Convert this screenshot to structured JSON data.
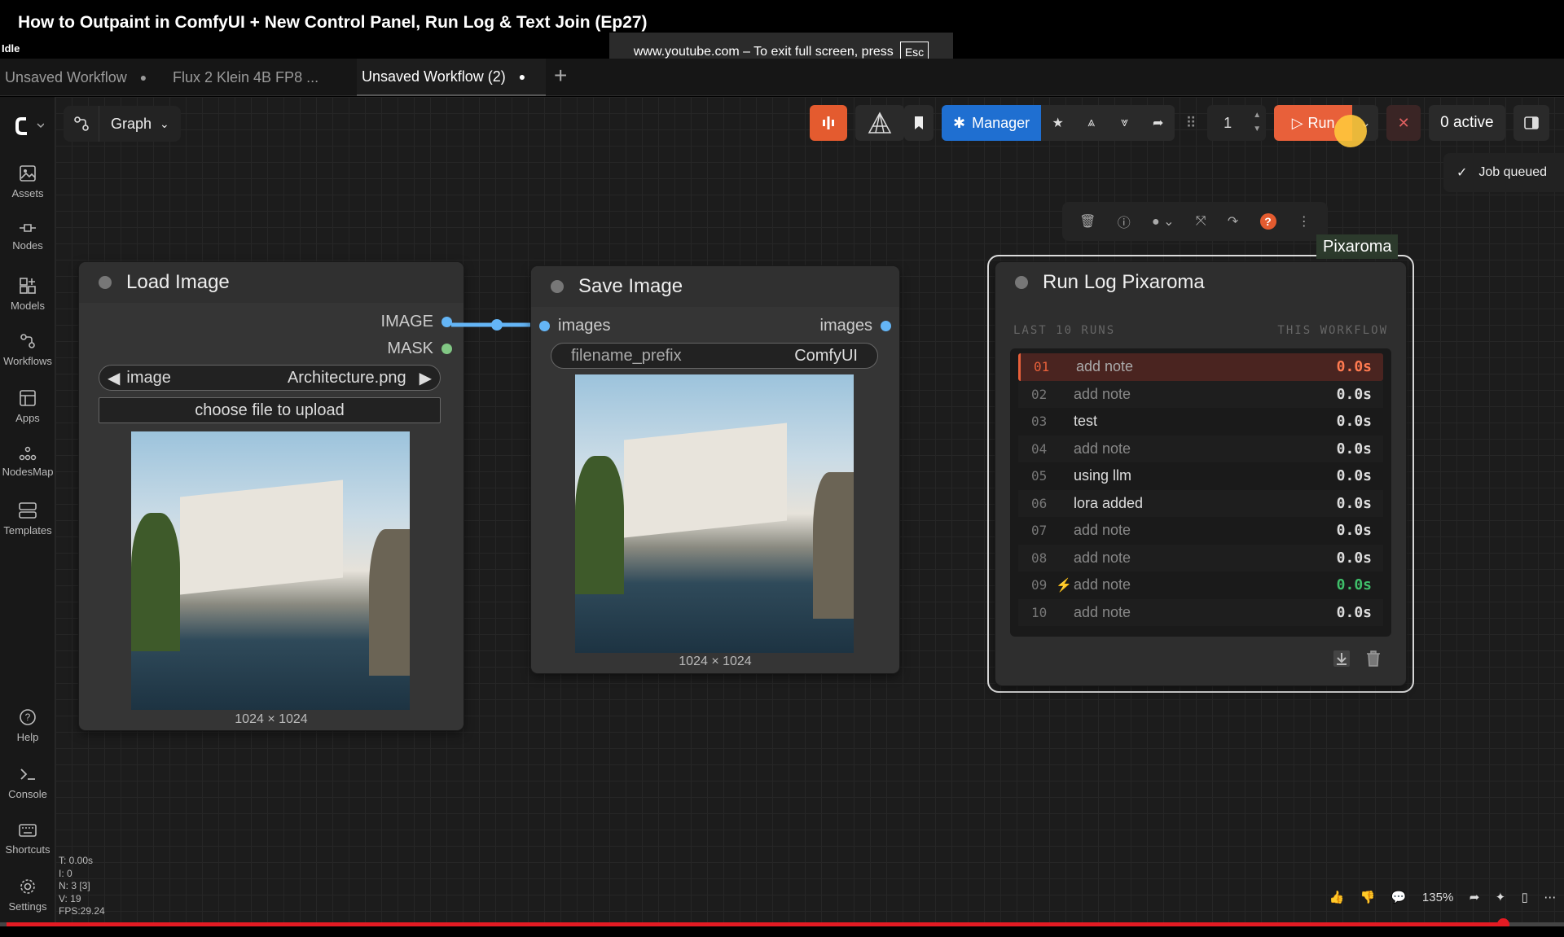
{
  "video": {
    "title": "How to Outpaint in ComfyUI + New Control Panel, Run Log & Text Join (Ep27)",
    "fullscreen_notice": "www.youtube.com – To exit full screen, press",
    "esc_key": "Esc"
  },
  "status": "Idle",
  "tabs": [
    {
      "label": "Unsaved Workflow",
      "modified": "●"
    },
    {
      "label": "Flux 2 Klein 4B FP8 ...",
      "modified": ""
    },
    {
      "label": "Unsaved Workflow (2)",
      "modified": "●"
    }
  ],
  "tab_add": "+",
  "sidebar": {
    "items": [
      {
        "label": "Assets",
        "icon": "image-icon"
      },
      {
        "label": "Nodes",
        "icon": "nodes-icon"
      },
      {
        "label": "Models",
        "icon": "models-icon"
      },
      {
        "label": "Workflows",
        "icon": "workflow-icon"
      },
      {
        "label": "Apps",
        "icon": "apps-icon"
      },
      {
        "label": "NodesMap",
        "icon": "nodesmap-icon"
      },
      {
        "label": "Templates",
        "icon": "templates-icon"
      },
      {
        "label": "Help",
        "icon": "help-icon"
      },
      {
        "label": "Console",
        "icon": "console-icon"
      },
      {
        "label": "Shortcuts",
        "icon": "keyboard-icon"
      },
      {
        "label": "Settings",
        "icon": "gear-icon"
      }
    ]
  },
  "graph_menu": {
    "label": "Graph"
  },
  "toolbar": {
    "manager_label": "Manager",
    "queue_count": "1",
    "run_label": "Run",
    "active_label": "0 active"
  },
  "toast": {
    "label": "Job queued"
  },
  "nodes": {
    "load_image": {
      "title": "Load Image",
      "outputs": [
        "IMAGE",
        "MASK"
      ],
      "image_widget_label": "image",
      "image_widget_value": "Architecture.png",
      "upload_label": "choose file to upload",
      "size": "1024 × 1024"
    },
    "save_image": {
      "title": "Save Image",
      "input": "images",
      "output": "images",
      "prefix_label": "filename_prefix",
      "prefix_value": "ComfyUI",
      "size": "1024 × 1024"
    },
    "run_log": {
      "tag": "Pixaroma",
      "title": "Run Log Pixaroma",
      "header_left": "LAST 10 RUNS",
      "header_right": "THIS WORKFLOW",
      "rows": [
        {
          "num": "01",
          "note": "add note",
          "time": "0.0s",
          "flag": ""
        },
        {
          "num": "02",
          "note": "add note",
          "time": "0.0s",
          "flag": ""
        },
        {
          "num": "03",
          "note": "test",
          "time": "0.0s",
          "flag": ""
        },
        {
          "num": "04",
          "note": "add note",
          "time": "0.0s",
          "flag": ""
        },
        {
          "num": "05",
          "note": "using llm",
          "time": "0.0s",
          "flag": ""
        },
        {
          "num": "06",
          "note": "lora added",
          "time": "0.0s",
          "flag": ""
        },
        {
          "num": "07",
          "note": "add note",
          "time": "0.0s",
          "flag": ""
        },
        {
          "num": "08",
          "note": "add note",
          "time": "0.0s",
          "flag": ""
        },
        {
          "num": "09",
          "note": "add note",
          "time": "0.0s",
          "flag": "⚡"
        },
        {
          "num": "10",
          "note": "add note",
          "time": "0.0s",
          "flag": ""
        }
      ]
    }
  },
  "stats": {
    "t": "T: 0.00s",
    "i": "I: 0",
    "n": "N: 3 [3]",
    "v": "V: 19",
    "fps": "FPS:29.24"
  },
  "player": {
    "zoom": "135%",
    "progress_fraction": 0.965
  }
}
